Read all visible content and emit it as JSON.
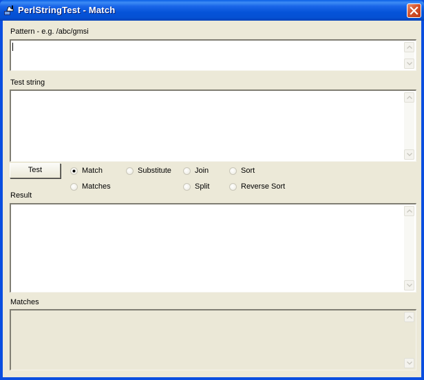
{
  "window": {
    "title": "PerlStringTest - Match",
    "app_icon": "perl-camel-icon",
    "close_icon": "close-icon"
  },
  "pattern": {
    "label": "Pattern - e.g. /abc/gmsi",
    "value": ""
  },
  "test_string": {
    "label": "Test string",
    "value": ""
  },
  "actions": {
    "test_button": "Test"
  },
  "modes": {
    "selected": "Match",
    "options": [
      "Match",
      "Substitute",
      "Join",
      "Sort",
      "Matches",
      "Split",
      "Reverse Sort"
    ]
  },
  "result": {
    "label": "Result",
    "value": ""
  },
  "matches": {
    "label": "Matches",
    "value": ""
  }
}
